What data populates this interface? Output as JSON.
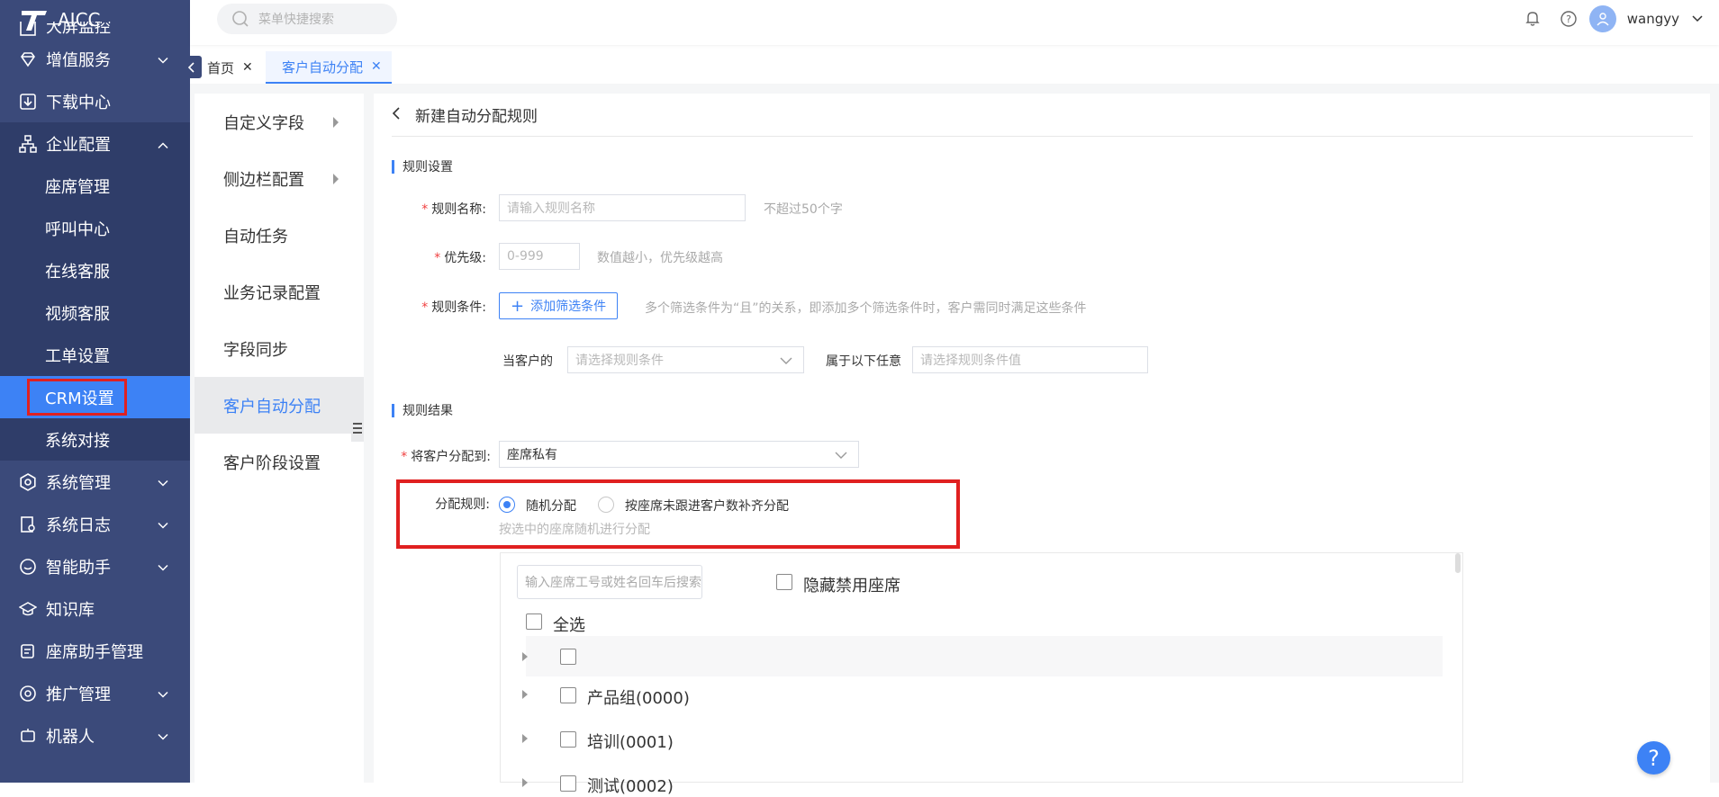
{
  "app": {
    "title": "AICC"
  },
  "sidebar": {
    "items": [
      {
        "label": "大屏监控",
        "icon": "dashboard-icon"
      },
      {
        "label": "增值服务",
        "icon": "diamond-icon"
      },
      {
        "label": "下载中心",
        "icon": "download-icon"
      },
      {
        "label": "企业配置",
        "icon": "org-icon"
      },
      {
        "label": "系统管理",
        "icon": "gear-icon"
      },
      {
        "label": "系统日志",
        "icon": "log-icon"
      },
      {
        "label": "智能助手",
        "icon": "chat-icon"
      },
      {
        "label": "知识库",
        "icon": "graduation-icon"
      },
      {
        "label": "座席助手管理",
        "icon": "assistant-icon"
      },
      {
        "label": "推广管理",
        "icon": "promote-icon"
      },
      {
        "label": "机器人",
        "icon": "robot-icon"
      }
    ],
    "sub_items": [
      "座席管理",
      "呼叫中心",
      "在线客服",
      "视频客服",
      "工单设置",
      "CRM设置",
      "系统对接"
    ]
  },
  "topbar": {
    "search_placeholder": "菜单快捷搜索",
    "username": "wangyy"
  },
  "tabs": [
    {
      "label": "首页"
    },
    {
      "label": "客户自动分配"
    }
  ],
  "menu2": [
    "自定义字段",
    "侧边栏配置",
    "自动任务",
    "业务记录配置",
    "字段同步",
    "客户自动分配",
    "客户阶段设置"
  ],
  "form": {
    "page_title": "新建自动分配规则",
    "section_rule": "规则设置",
    "name_label": "规则名称:",
    "name_placeholder": "请输入规则名称",
    "name_hint": "不超过50个字",
    "priority_label": "优先级:",
    "priority_placeholder": "0-999",
    "priority_hint": "数值越小，优先级越高",
    "condition_label": "规则条件:",
    "add_condition": "添加筛选条件",
    "condition_hint": "多个筛选条件为“且”的关系，即添加多个筛选条件时，客户需同时满足这些条件",
    "current_customer": "当客户的",
    "cond_select_placeholder": "请选择规则条件",
    "belongs_any": "属于以下任意",
    "cond_value_placeholder": "请选择规则条件值",
    "section_result": "规则结果",
    "assign_label": "将客户分配到:",
    "assign_value": "座席私有",
    "dist_label": "分配规则:",
    "dist_options": [
      "随机分配",
      "按座席未跟进客户数补齐分配"
    ],
    "dist_hint": "按选中的座席随机进行分配",
    "seat_search_placeholder": "输入座席工号或姓名回车后搜索",
    "hide_disabled": "隐藏禁用座席",
    "select_all": "全选",
    "tree_items": [
      "",
      "产品组(0000)",
      "培训(0001)",
      "测试(0002)"
    ]
  },
  "help": "?"
}
